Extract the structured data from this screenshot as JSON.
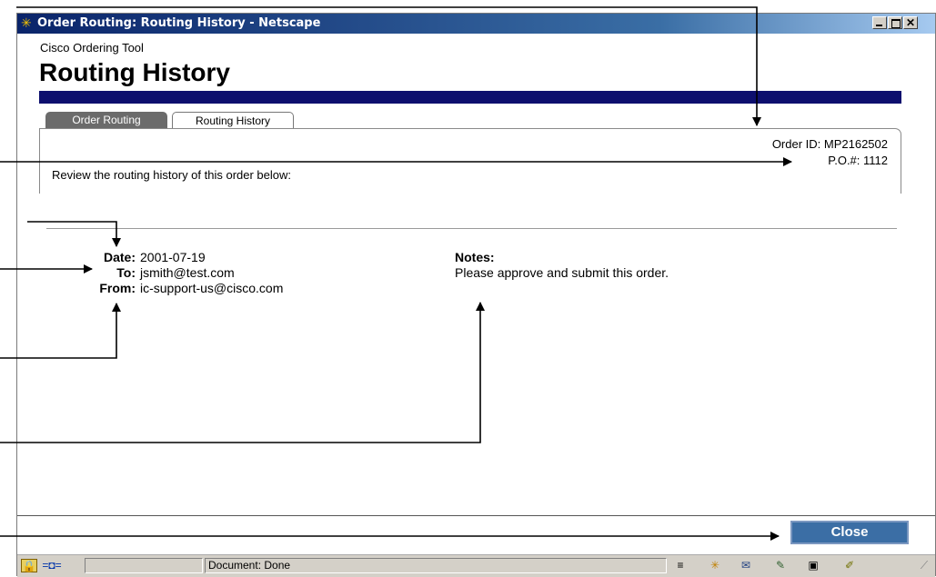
{
  "window": {
    "title": "Order Routing: Routing History - Netscape"
  },
  "header": {
    "app_name": "Cisco Ordering Tool",
    "page_title": "Routing History"
  },
  "tabs": [
    {
      "label": "Order Routing",
      "active": false
    },
    {
      "label": "Routing History",
      "active": true
    }
  ],
  "order": {
    "id_label": "Order ID: MP2162502",
    "po_label": "P.O.#: 1112",
    "review_text": "Review the routing history of this order below:"
  },
  "history": {
    "date_label": "Date:",
    "date_value": "2001-07-19",
    "to_label": "To:",
    "to_value": "jsmith@test.com",
    "from_label": "From:",
    "from_value": "ic-support-us@cisco.com",
    "notes_label": "Notes:",
    "notes_value": "Please approve and submit this order."
  },
  "actions": {
    "close_label": "Close"
  },
  "statusbar": {
    "text": "Document: Done"
  },
  "colors": {
    "title_bar": "#0a246a",
    "blue_bar": "#0d0f6e",
    "close_button": "#3b6ea5"
  }
}
